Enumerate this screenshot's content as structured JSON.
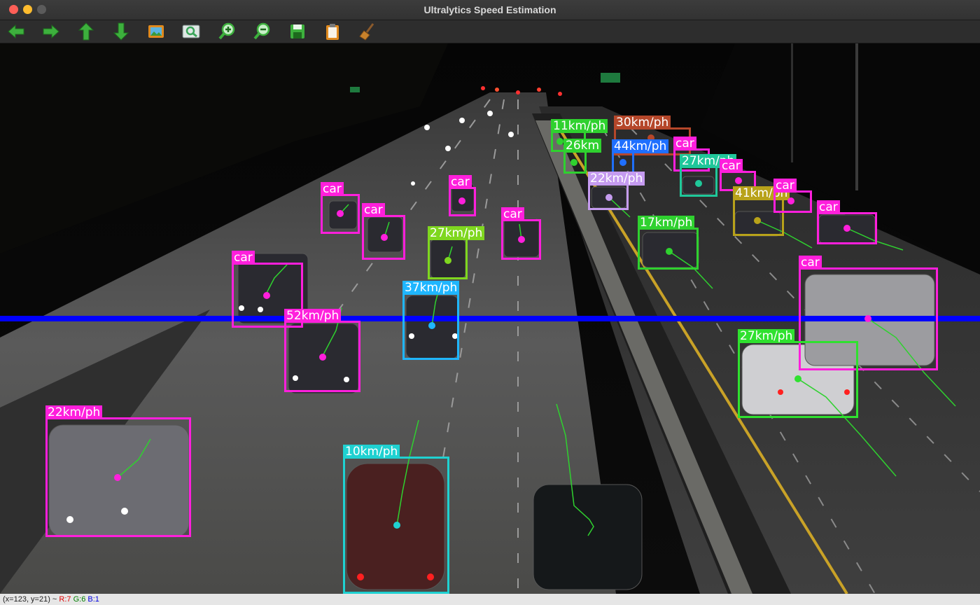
{
  "window": {
    "title": "Ultralytics Speed Estimation"
  },
  "toolbar": {
    "buttons": [
      {
        "name": "back-arrow-icon",
        "color": "#3db03d"
      },
      {
        "name": "forward-arrow-icon",
        "color": "#3db03d"
      },
      {
        "name": "up-arrow-icon",
        "color": "#3db03d"
      },
      {
        "name": "down-arrow-icon",
        "color": "#3db03d"
      },
      {
        "name": "image-icon",
        "color": "#e08a1e"
      },
      {
        "name": "zoom-fit-icon",
        "color": "#3aa55a"
      },
      {
        "name": "zoom-in-icon",
        "color": "#3db03d"
      },
      {
        "name": "zoom-out-icon",
        "color": "#3db03d"
      },
      {
        "name": "save-icon",
        "color": "#3db03d"
      },
      {
        "name": "clipboard-icon",
        "color": "#e08a1e"
      },
      {
        "name": "broom-icon",
        "color": "#c9822b"
      }
    ]
  },
  "detections": [
    {
      "label": "11km/ph",
      "color": "#2fd12f"
    },
    {
      "label": "30km/ph",
      "color": "#b5472a"
    },
    {
      "label": "26km",
      "color": "#2fd12f"
    },
    {
      "label": "44km/ph",
      "color": "#1f6fff"
    },
    {
      "label": "car",
      "color": "#ff1fdc"
    },
    {
      "label": "27km/ph",
      "color": "#1fc79a"
    },
    {
      "label": "22km/ph",
      "color": "#c59bf0"
    },
    {
      "label": "car",
      "color": "#ff1fdc"
    },
    {
      "label": "41km/ph",
      "color": "#b8a21a"
    },
    {
      "label": "car",
      "color": "#ff1fdc"
    },
    {
      "label": "car",
      "color": "#ff1fdc"
    },
    {
      "label": "car",
      "color": "#ff1fdc"
    },
    {
      "label": "car",
      "color": "#ff1fdc"
    },
    {
      "label": "car",
      "color": "#ff1fdc"
    },
    {
      "label": "car",
      "color": "#ff1fdc"
    },
    {
      "label": "27km/ph",
      "color": "#7fd71f"
    },
    {
      "label": "car",
      "color": "#ff1fdc"
    },
    {
      "label": "17km/ph",
      "color": "#2fd12f"
    },
    {
      "label": "37km/ph",
      "color": "#1fb6ff"
    },
    {
      "label": "52km/ph",
      "color": "#ff1fdc"
    },
    {
      "label": "car",
      "color": "#ff1fdc"
    },
    {
      "label": "27km/ph",
      "color": "#2fe12f"
    },
    {
      "label": "22km/ph",
      "color": "#ff1fdc"
    },
    {
      "label": "10km/ph",
      "color": "#1fd1d1"
    }
  ],
  "counting_line": {
    "color": "#0000ff"
  },
  "status": {
    "coords": "(x=123, y=21) ~",
    "r": "R:7",
    "g": "G:6",
    "b": "B:1"
  }
}
